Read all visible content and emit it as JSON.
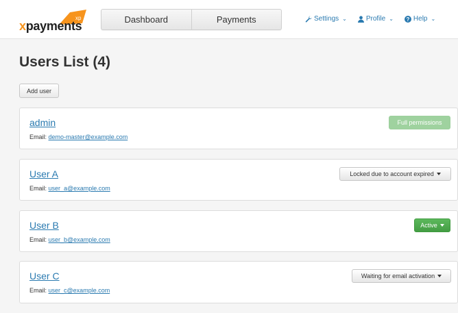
{
  "brand": {
    "logo_text": "payments",
    "logo_x": "x",
    "logo_badge": "xp",
    "accent": "#f7941d"
  },
  "nav": {
    "tabs": [
      {
        "label": "Dashboard"
      },
      {
        "label": "Payments"
      }
    ]
  },
  "top_links": [
    {
      "label": "Settings",
      "icon": "wrench-icon"
    },
    {
      "label": "Profile",
      "icon": "user-icon"
    },
    {
      "label": "Help",
      "icon": "question-circle-icon"
    }
  ],
  "page": {
    "title": "Users List (4)",
    "add_user_label": "Add user"
  },
  "users": [
    {
      "name": "admin",
      "email_label": "Email:",
      "email": "demo-master@example.com",
      "status": "Full permissions",
      "status_style": "disabled"
    },
    {
      "name": "User A",
      "email_label": "Email:",
      "email": "user_a@example.com",
      "status": "Locked due to account expired",
      "status_style": "default"
    },
    {
      "name": "User B",
      "email_label": "Email:",
      "email": "user_b@example.com",
      "status": "Active",
      "status_style": "green"
    },
    {
      "name": "User C",
      "email_label": "Email:",
      "email": "user_c@example.com",
      "status": "Waiting for email activation",
      "status_style": "default"
    }
  ]
}
